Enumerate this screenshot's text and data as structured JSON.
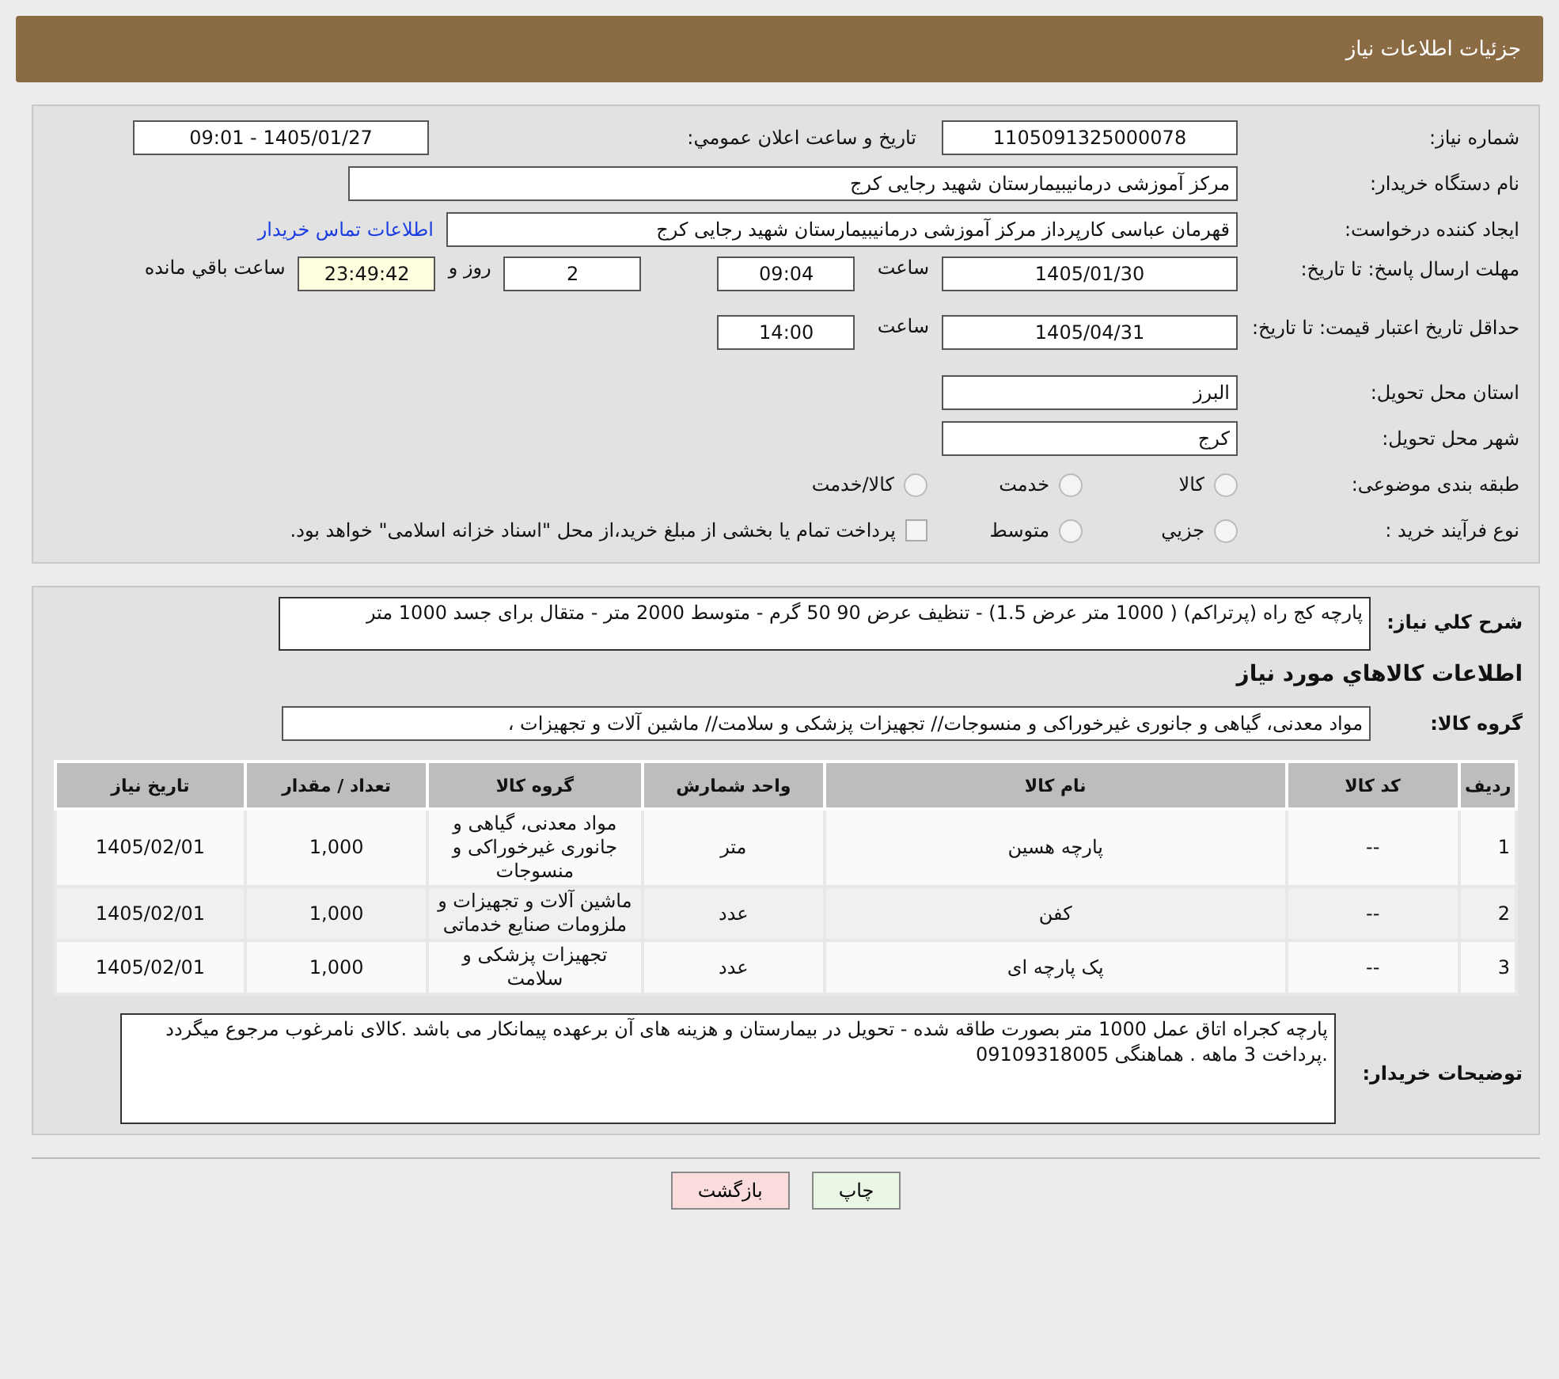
{
  "header": {
    "title": "جزئیات اطلاعات نیاز"
  },
  "details": {
    "need_number": {
      "label": "شماره نیاز:",
      "value": "1105091325000078"
    },
    "announce": {
      "label": "تاریخ و ساعت اعلان عمومي:",
      "value": "1405/01/27 - 09:01"
    },
    "buyer": {
      "label": "نام دستگاه خریدار:",
      "value": "مرکز آموزشی درمانیبیمارستان شهید رجایی کرج"
    },
    "creator": {
      "label": "ایجاد کننده درخواست:",
      "value": "قهرمان عباسی کارپرداز مرکز آموزشی درمانیبیمارستان شهید رجایی کرج",
      "link": "اطلاعات تماس خریدار"
    },
    "deadline": {
      "label": "مهلت ارسال پاسخ: تا تاریخ:",
      "date": "1405/01/30",
      "time_label": "ساعت",
      "time": "09:04",
      "days": "2",
      "days_label": "روز و",
      "remaining": "23:49:42",
      "remaining_label": "ساعت باقي مانده"
    },
    "validity": {
      "label": "حداقل تاریخ اعتبار قیمت: تا تاریخ:",
      "date": "1405/04/31",
      "time_label": "ساعت",
      "time": "14:00"
    },
    "province": {
      "label": "استان محل تحویل:",
      "value": "البرز"
    },
    "city": {
      "label": "شهر محل تحویل:",
      "value": "کرج"
    },
    "category": {
      "label": "طبقه بندی موضوعی:",
      "options": [
        {
          "label": "کالا",
          "selected": false
        },
        {
          "label": "خدمت",
          "selected": false
        },
        {
          "label": "کالا/خدمت",
          "selected": false
        }
      ]
    },
    "purchase_type": {
      "label": "نوع فرآیند خرید :",
      "options": [
        {
          "label": "جزيي",
          "selected": false
        },
        {
          "label": "متوسط",
          "selected": false
        }
      ],
      "payment_note": {
        "label": "پرداخت تمام یا بخشی از مبلغ خرید،از محل \"اسناد خزانه اسلامی\" خواهد بود.",
        "checked": false
      }
    }
  },
  "goods": {
    "summary": {
      "label": "شرح کلي نیاز:",
      "value": "پارچه کج راه (پرتراکم)  ( 1000 متر عرض 1.5) -  تنظیف عرض 90  50 گرم - متوسط   2000  متر -  متقال  برای جسد 1000 متر"
    },
    "heading": "اطلاعات کالاهاي مورد نیاز",
    "group": {
      "label": "گروه کالا:",
      "value": "مواد معدنی، گیاهی و جانوری غیرخوراکی و منسوجات// تجهیزات پزشکی و سلامت// ماشین آلات و تجهیزات ،"
    },
    "table": {
      "columns": [
        "ردیف",
        "کد کالا",
        "نام کالا",
        "واحد شمارش",
        "گروه کالا",
        "تعداد / مقدار",
        "تاریخ نیاز"
      ],
      "rows": [
        [
          "1",
          "--",
          "پارچه هسین",
          "متر",
          "مواد معدنی، گیاهی و جانوری غیرخوراکی و منسوجات",
          "1,000",
          "1405/02/01"
        ],
        [
          "2",
          "--",
          "کفن",
          "عدد",
          "ماشین آلات و تجهیزات و ملزومات صنایع خدماتی",
          "1,000",
          "1405/02/01"
        ],
        [
          "3",
          "--",
          "پک پارچه ای",
          "عدد",
          "تجهیزات پزشکی و سلامت",
          "1,000",
          "1405/02/01"
        ]
      ]
    },
    "notes": {
      "label": "توضیحات خریدار:",
      "value": "پارچه کجراه اتاق عمل 1000 متر بصورت طاقه  شده - تحویل در بیمارستان و هزینه های آن برعهده پیمانکار می باشد .کالای نامرغوب مرجوع میگردد .پرداخت 3 ماهه . هماهنگی 09109318005"
    }
  },
  "buttons": [
    {
      "label": "چاپ",
      "kind": "print"
    },
    {
      "label": "بازگشت",
      "kind": "back"
    }
  ]
}
